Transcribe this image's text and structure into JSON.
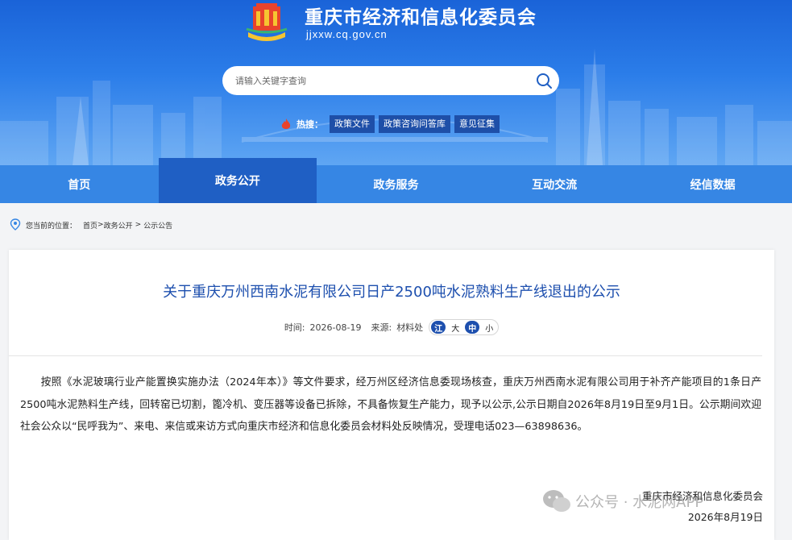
{
  "header": {
    "site_title": "重庆市经济和信息化委员会",
    "site_domain": "jjxxw.cq.gov.cn",
    "search_placeholder": "请输入关键字查询",
    "hot_label": "热搜：",
    "hot_tags": [
      "政策文件",
      "政策咨询问答库",
      "意见征集"
    ]
  },
  "nav": {
    "items": [
      "首页",
      "政务公开",
      "政务服务",
      "互动交流",
      "经信数据"
    ],
    "active_index": 1
  },
  "breadcrumb": {
    "label": "您当前的位置：",
    "home": "首页",
    "sep1": ">",
    "section": "政务公开",
    "sep2": ">",
    "current": "公示公告"
  },
  "article": {
    "title": "关于重庆万州西南水泥有限公司日产2500吨水泥熟料生产线退出的公示",
    "time_label": "时间:",
    "time_value": "2026-08-19",
    "source_label": "来源:",
    "source_value": "材料处",
    "font_tools": [
      "江",
      "大",
      "中",
      "小"
    ],
    "body": "按照《水泥玻璃行业产能置换实施办法（2024年本）》等文件要求，经万州区经济信息委现场核查，重庆万州西南水泥有限公司用于补齐产能项目的1条日产2500吨水泥熟料生产线，回转窑已切割，篦冷机、变压器等设备已拆除，不具备恢复生产能力，现予以公示,公示日期自2026年8月19日至9月1日。公示期间欢迎社会公众以“民呼我为”、来电、来信或来访方式向重庆市经济和信息化委员会材料处反映情况，受理电话023—63898636。",
    "signature_org": "重庆市经济和信息化委员会",
    "signature_date": "2026年8月19日"
  },
  "watermark": {
    "text": "公众号 · 水泥网APP"
  },
  "colors": {
    "banner_top": "#1a63d8",
    "nav_bg": "#3686e4",
    "nav_active": "#1f5fc4",
    "title_blue": "#1d4fae",
    "hot_tag_bg": "#1e4fa8"
  }
}
